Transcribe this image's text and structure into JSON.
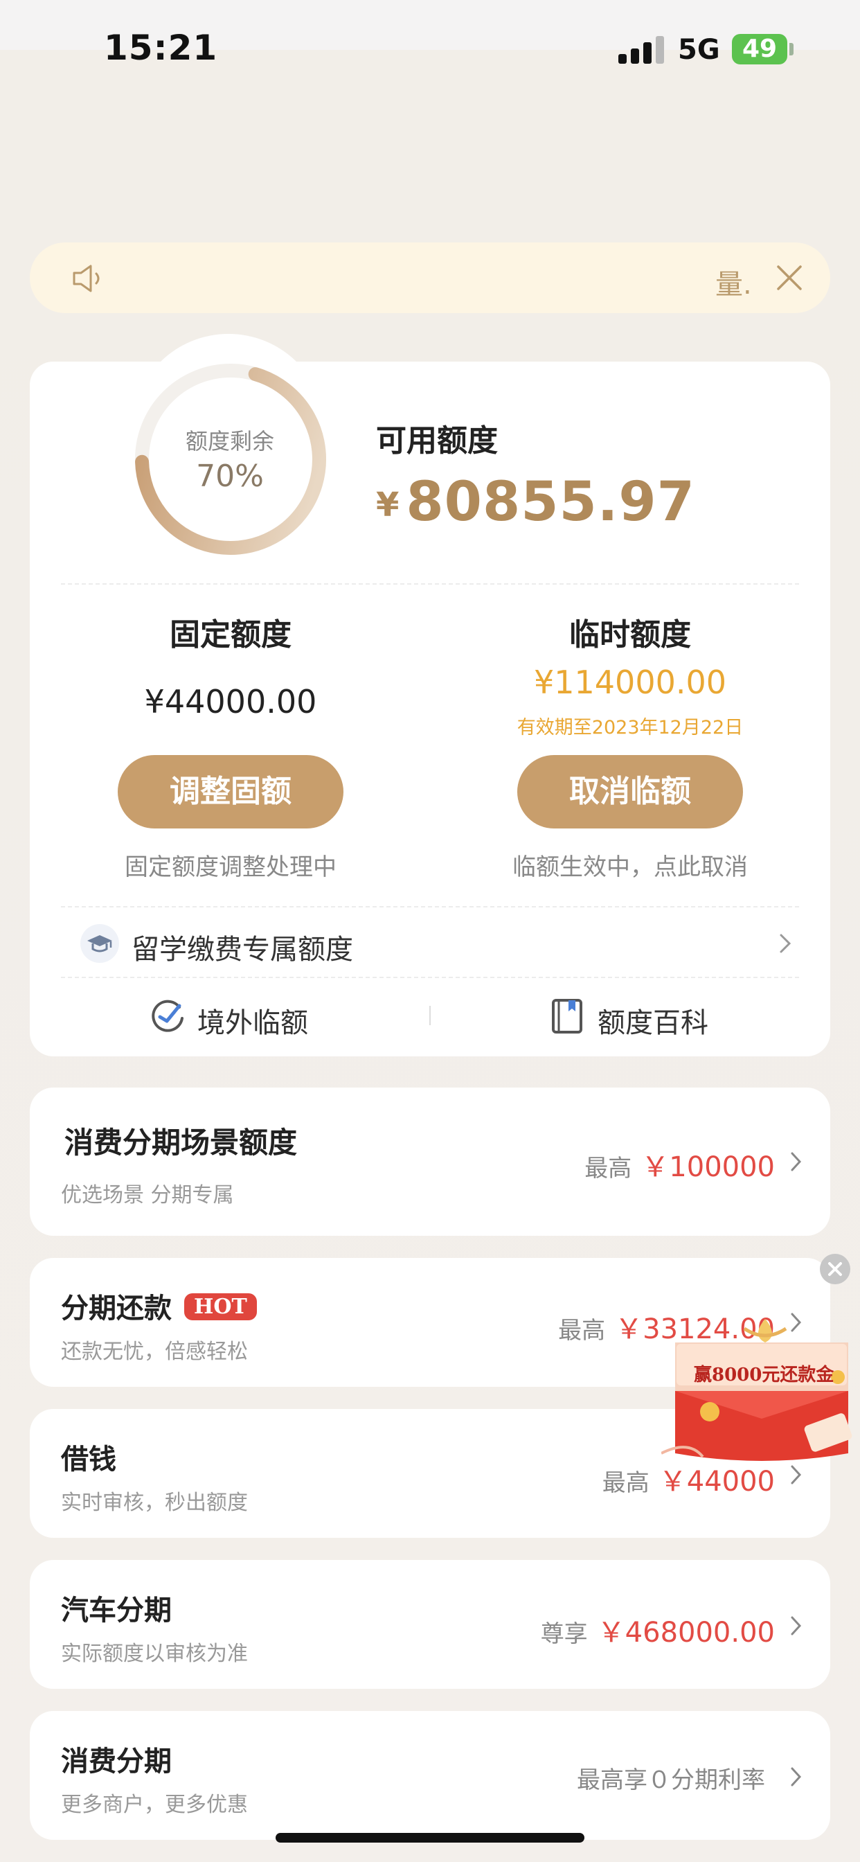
{
  "status_bar": {
    "time": "15:21",
    "network": "5G",
    "battery": "49"
  },
  "notice": {
    "text": "量."
  },
  "credit": {
    "ring_label": "额度剩余",
    "ring_percent_text": "70%",
    "ring_fraction": 0.7,
    "available_title": "可用额度",
    "currency_symbol": "¥",
    "available_amount": "80855.97"
  },
  "fixed_limit": {
    "title": "固定额度",
    "amount": "¥44000.00",
    "button": "调整固额",
    "note": "固定额度调整处理中"
  },
  "temp_limit": {
    "title": "临时额度",
    "amount": "¥114000.00",
    "valid_until": "有效期至2023年12月22日",
    "button": "取消临额",
    "note": "临额生效中，点此取消"
  },
  "study_abroad": {
    "label": "留学缴费专属额度"
  },
  "links": {
    "overseas": "境外临额",
    "encyclopedia": "额度百科"
  },
  "cards": [
    {
      "title": "消费分期场景额度",
      "subtitle": "优选场景 分期专属",
      "prefix": "最高",
      "amount": "￥100000"
    },
    {
      "title": "分期还款",
      "badge": "HOT",
      "subtitle": "还款无忧，倍感轻松",
      "prefix": "最高",
      "amount": "￥33124.00"
    },
    {
      "title": "借钱",
      "subtitle": "实时审核，秒出额度",
      "prefix": "最高",
      "amount": "￥44000"
    },
    {
      "title": "汽车分期",
      "subtitle": "实际额度以审核为准",
      "prefix": "尊享",
      "amount": "￥468000.00"
    },
    {
      "title": "消费分期",
      "subtitle": "更多商户，更多优惠",
      "prefix": "最高享０分期利率",
      "amount": ""
    }
  ],
  "promo": {
    "text": "赢8000元还款金"
  },
  "colors": {
    "gold": "#c89e6c",
    "accent_red": "#e24b44",
    "temp_amber": "#e9a733",
    "background": "#f3efeb"
  }
}
